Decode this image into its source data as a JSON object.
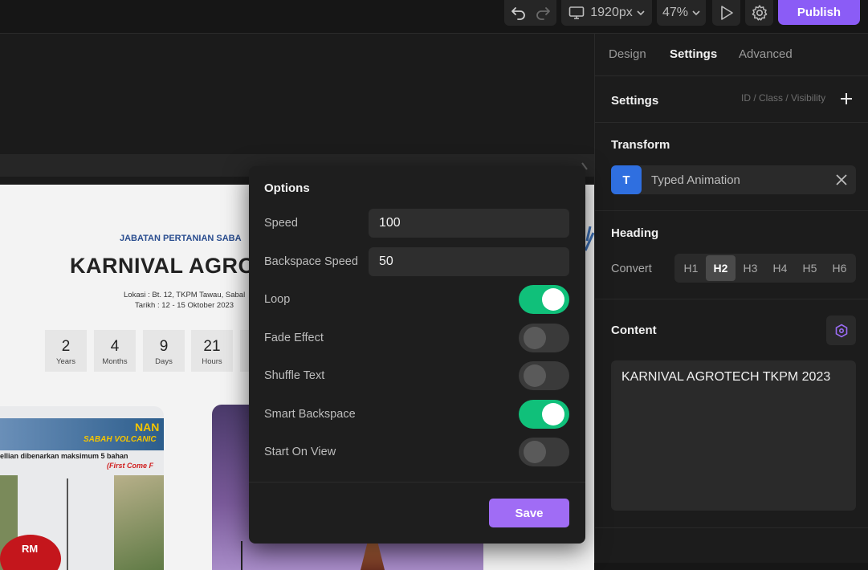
{
  "topbar": {
    "device": "1920px",
    "zoom": "47%",
    "publish_label": "Publish"
  },
  "canvas": {
    "department": "JABATAN PERTANIAN SABA",
    "title": "KARNIVAL AGROT",
    "location": "Lokasi : Bt. 12, TKPM Tawau, Sabal",
    "date": "Tarikh : 12 - 15 Oktober 2023",
    "countdown": [
      {
        "value": "2",
        "label": "Years"
      },
      {
        "value": "4",
        "label": "Months"
      },
      {
        "value": "9",
        "label": "Days"
      },
      {
        "value": "21",
        "label": "Hours"
      }
    ],
    "banner_heading": "NAN",
    "banner_sub": "SABAH VOLCANIC",
    "banner_note": "ellian dibenarkan maksimum 5 bahan",
    "banner_note2": "(First Come F",
    "badge": "RM"
  },
  "panel": {
    "tabs": [
      "Design",
      "Settings",
      "Advanced"
    ],
    "settings_title": "Settings",
    "settings_link": "ID / Class / Visibility",
    "transform_title": "Transform",
    "transform_chip_letter": "T",
    "transform_chip_label": "Typed Animation",
    "heading_title": "Heading",
    "convert_label": "Convert",
    "heading_levels": [
      "H1",
      "H2",
      "H3",
      "H4",
      "H5",
      "H6"
    ],
    "content_title": "Content",
    "content_text": "KARNIVAL AGROTECH TKPM 2023"
  },
  "modal": {
    "title": "Options",
    "speed_label": "Speed",
    "speed_value": "100",
    "backspace_label": "Backspace Speed",
    "backspace_value": "50",
    "toggles": [
      {
        "label": "Loop",
        "on": true
      },
      {
        "label": "Fade Effect",
        "on": false
      },
      {
        "label": "Shuffle Text",
        "on": false
      },
      {
        "label": "Smart Backspace",
        "on": true
      },
      {
        "label": "Start On View",
        "on": false
      }
    ],
    "save_label": "Save"
  },
  "colors": {
    "accent": "#8b5cf6",
    "toggle_on": "#10c07a",
    "chip_blue": "#2f6fe0"
  },
  "icons": [
    "undo-icon",
    "redo-icon",
    "monitor-icon",
    "chevron-down-icon",
    "play-icon",
    "gear-icon",
    "plus-icon",
    "close-icon",
    "hexagon-icon"
  ]
}
